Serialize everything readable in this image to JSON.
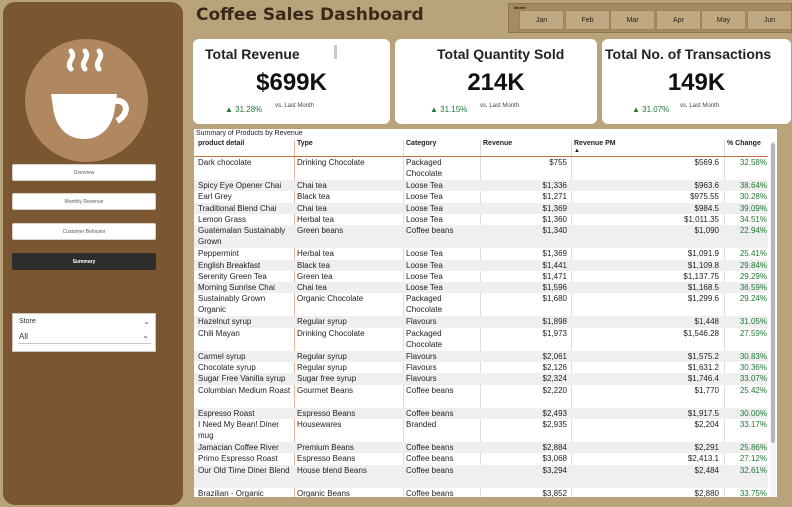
{
  "title": "Coffee Sales Dashboard",
  "nav": [
    {
      "label": "Overview",
      "active": false
    },
    {
      "label": "Monthly Revenue",
      "active": false
    },
    {
      "label": "Customer Behavior",
      "active": false
    },
    {
      "label": "Summary",
      "active": true
    }
  ],
  "slicer": {
    "title": "Store",
    "value": "All"
  },
  "month_filter": {
    "label": "Month",
    "months": [
      "Jan",
      "Feb",
      "Mar",
      "Apr",
      "May",
      "Jun"
    ]
  },
  "kpis": [
    {
      "title": "Total Revenue",
      "value": "$699K",
      "change": "▲ 31.28%",
      "vs": "vs. Last Month"
    },
    {
      "title": "Total Quantity Sold",
      "value": "214K",
      "change": "▲ 31.15%",
      "vs": "vs. Last Month"
    },
    {
      "title": "Total No. of Transactions",
      "value": "149K",
      "change": "▲ 31.07%",
      "vs": "vs. Last Month"
    }
  ],
  "table": {
    "caption": "Summary of Products by Revenue",
    "headers": [
      "product detail",
      "Type",
      "Category",
      "Revenue",
      "Revenue PM",
      "% Change"
    ],
    "sort_icon": "▲",
    "rows": [
      [
        "Dark chocolate",
        "Drinking Chocolate",
        "Packaged Chocolate",
        "$755",
        "$569.6",
        "32.58%"
      ],
      [
        "Spicy Eye Opener Chai",
        "Chai tea",
        "Loose Tea",
        "$1,336",
        "$963.6",
        "38.64%"
      ],
      [
        "Earl Grey",
        "Black tea",
        "Loose Tea",
        "$1,271",
        "$975.55",
        "30.28%"
      ],
      [
        "Traditional Blend Chai",
        "Chai tea",
        "Loose Tea",
        "$1,369",
        "$984.5",
        "39.09%"
      ],
      [
        "Lemon Grass",
        "Herbal tea",
        "Loose Tea",
        "$1,360",
        "$1,011.35",
        "34.51%"
      ],
      [
        "Guatemalan Sustainably Grown",
        "Green beans",
        "Coffee beans",
        "$1,340",
        "$1,090",
        "22.94%"
      ],
      [
        "Peppermint",
        "Herbal tea",
        "Loose Tea",
        "$1,369",
        "$1,091.9",
        "25.41%"
      ],
      [
        "English Breakfast",
        "Black tea",
        "Loose Tea",
        "$1,441",
        "$1,109.8",
        "29.84%"
      ],
      [
        "Serenity Green Tea",
        "Green tea",
        "Loose Tea",
        "$1,471",
        "$1,137.75",
        "29.29%"
      ],
      [
        "Morning Sunrise Chai",
        "Chai tea",
        "Loose Tea",
        "$1,596",
        "$1,168.5",
        "36.59%"
      ],
      [
        "Sustainably Grown Organic",
        "Organic Chocolate",
        "Packaged Chocolate",
        "$1,680",
        "$1,299.6",
        "29.24%"
      ],
      [
        "Hazelnut syrup",
        "Regular syrup",
        "Flavours",
        "$1,898",
        "$1,448",
        "31.05%"
      ],
      [
        "Chili Mayan",
        "Drinking Chocolate",
        "Packaged Chocolate",
        "$1,973",
        "$1,546.28",
        "27.59%"
      ],
      [
        "Carmel syrup",
        "Regular syrup",
        "Flavours",
        "$2,061",
        "$1,575.2",
        "30.83%"
      ],
      [
        "Chocolate syrup",
        "Regular syrup",
        "Flavours",
        "$2,126",
        "$1,631.2",
        "30.36%"
      ],
      [
        "Sugar Free Vanilla syrup",
        "Sugar free syrup",
        "Flavours",
        "$2,324",
        "$1,746.4",
        "33.07%"
      ],
      [
        "Columbian Medium Roast",
        "Gourmet Beans",
        "Coffee beans",
        "$2,220",
        "$1,770",
        "25.42%"
      ],
      [
        "Espresso Roast",
        "Espresso Beans",
        "Coffee beans",
        "$2,493",
        "$1,917.5",
        "30.00%"
      ],
      [
        "I Need My Bean! Diner mug",
        "Housewares",
        "Branded",
        "$2,935",
        "$2,204",
        "33.17%"
      ],
      [
        "Jamacian Coffee River",
        "Premium Beans",
        "Coffee beans",
        "$2,884",
        "$2,291",
        "25.86%"
      ],
      [
        "Primo Espresso Roast",
        "Espresso Beans",
        "Coffee beans",
        "$3,068",
        "$2,413.1",
        "27.12%"
      ],
      [
        "Our Old Time Diner Blend",
        "House blend Beans",
        "Coffee beans",
        "$3,294",
        "$2,484",
        "32.61%"
      ],
      [
        "Brazilian - Organic",
        "Organic Beans",
        "Coffee beans",
        "$3,852",
        "$2,880",
        "33.75%"
      ]
    ]
  }
}
